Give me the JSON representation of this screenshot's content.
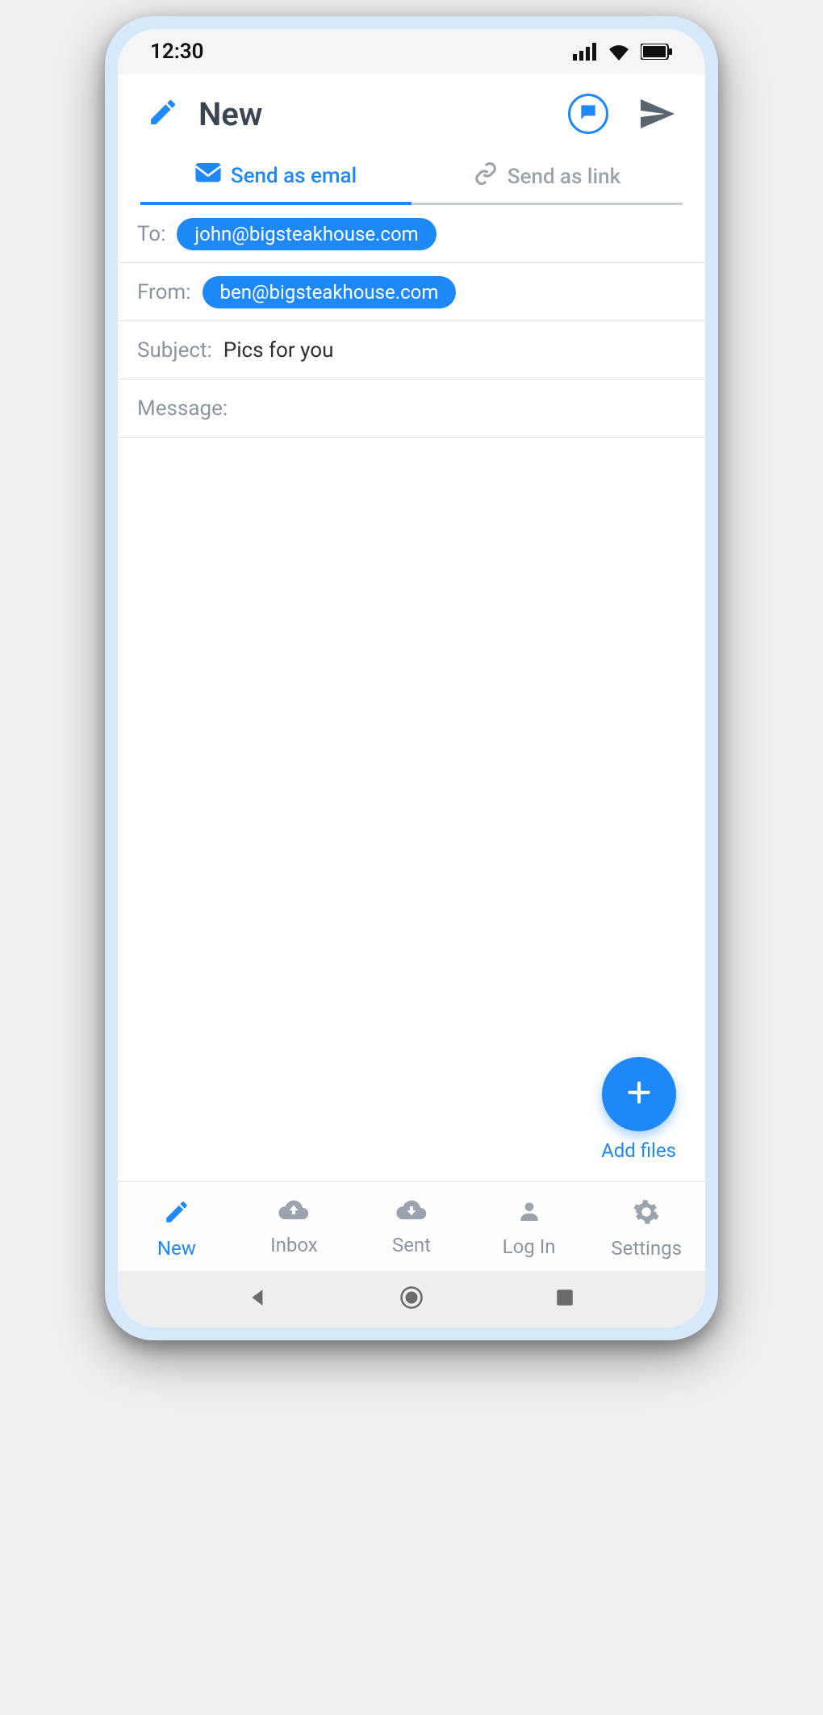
{
  "status": {
    "time": "12:30"
  },
  "header": {
    "title": "New"
  },
  "tabs": {
    "email": "Send as emal",
    "link": "Send as link",
    "active": "email"
  },
  "compose": {
    "to_label": "To:",
    "to_value": "john@bigsteakhouse.com",
    "from_label": "From:",
    "from_value": "ben@bigsteakhouse.com",
    "subject_label": "Subject:",
    "subject_value": "Pics for you",
    "message_label": "Message:"
  },
  "fab": {
    "label": "Add files"
  },
  "nav": {
    "new": "New",
    "inbox": "Inbox",
    "sent": "Sent",
    "login": "Log In",
    "settings": "Settings",
    "active": "new"
  }
}
